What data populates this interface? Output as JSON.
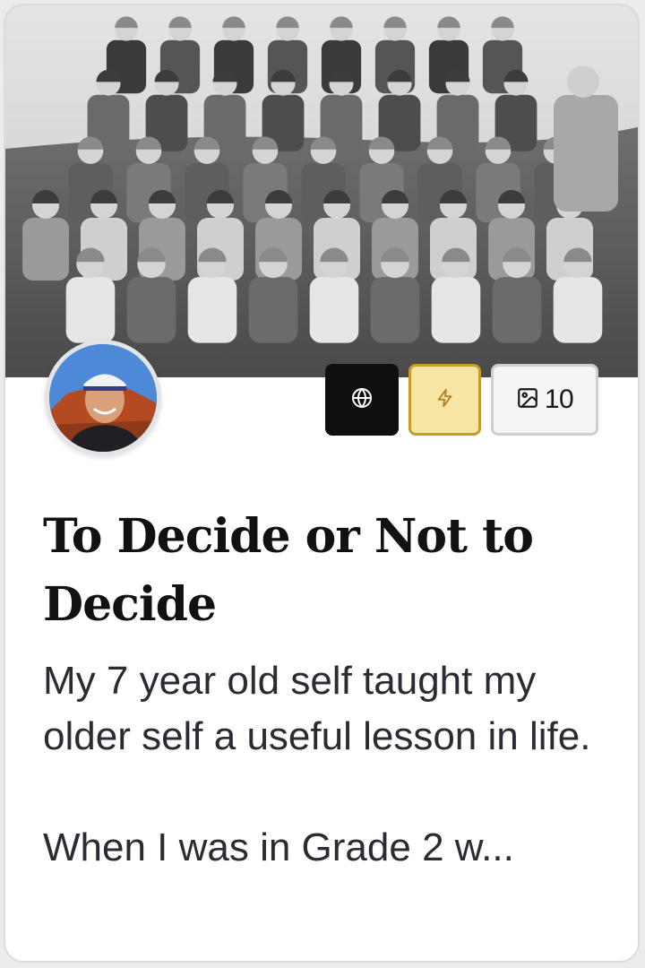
{
  "card": {
    "title": "To Decide or Not to Decide",
    "excerpt_line1": "My 7 year old self taught my older self a useful lesson in life.",
    "excerpt_line2": "When I was in Grade 2 w...",
    "cover_image_description_icon": "class-photo-image",
    "avatar_icon": "author-avatar"
  },
  "badges": {
    "globe_icon": "globe-icon",
    "bolt_icon": "lightning-icon",
    "images_icon": "image-icon",
    "image_count": "10"
  },
  "colors": {
    "globe_badge_bg": "#0f0f12",
    "bolt_badge_bg": "#f7e6a3",
    "bolt_badge_border": "#c89a2a",
    "images_badge_bg": "#f5f5f6"
  }
}
